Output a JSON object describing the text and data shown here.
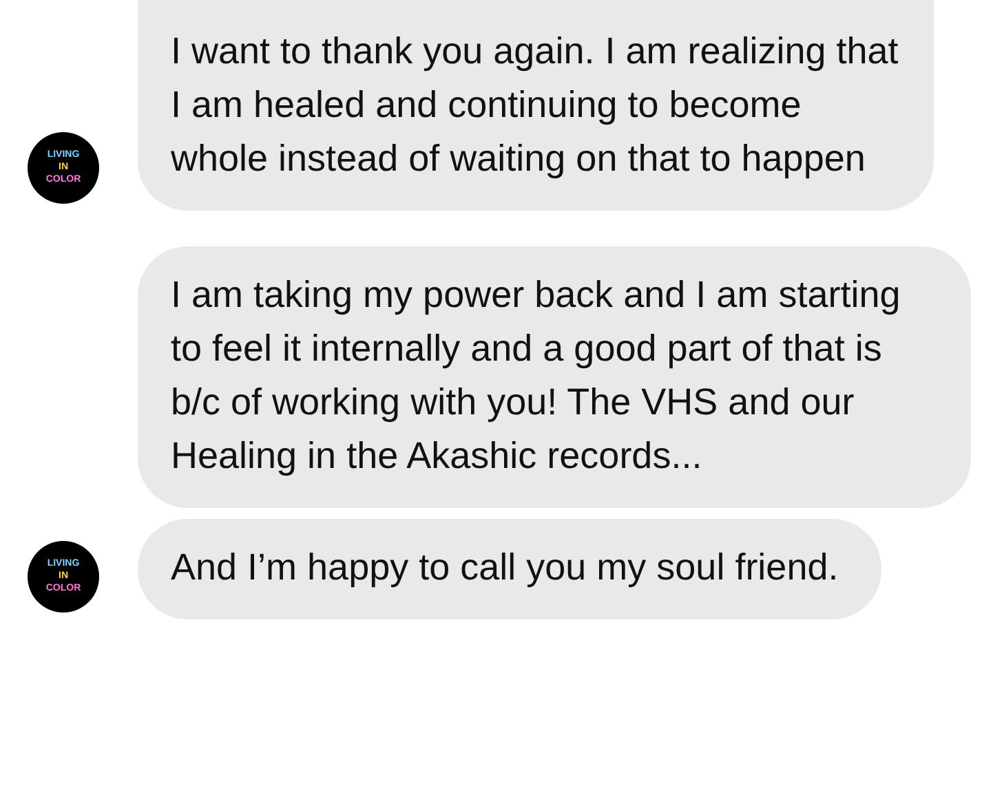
{
  "groups": [
    {
      "messages": [
        {
          "text": "I want to thank you again. I am realizing that I am healed and continuing to become whole instead of waiting on that to happen"
        }
      ],
      "avatar": {
        "logo_text": [
          "LIVING",
          "IN",
          "COLOR"
        ]
      }
    },
    {
      "messages": [
        {
          "text": "I am taking my power back and I am starting to feel it internally and a good part of that is b/c of working with you! The VHS and our Healing in the Akashic records..."
        },
        {
          "text": "And I’m happy to call you my soul friend."
        }
      ],
      "avatar": {
        "logo_text": [
          "LIVING",
          "IN",
          "COLOR"
        ]
      }
    }
  ]
}
